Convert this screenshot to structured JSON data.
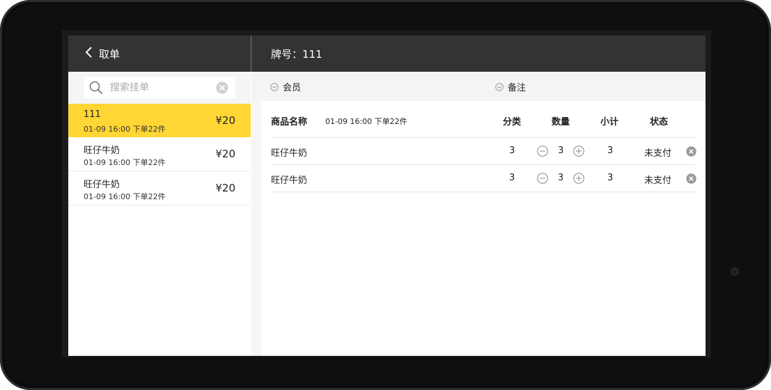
{
  "header": {
    "back_label": "取单",
    "table_label": "牌号：111"
  },
  "search": {
    "placeholder": "搜索挂单"
  },
  "orders": [
    {
      "name": "111",
      "meta": "01-09 16:00 下单22件",
      "price": "¥20",
      "active": true
    },
    {
      "name": "旺仔牛奶",
      "meta": "01-09 16:00 下单22件",
      "price": "¥20",
      "active": false
    },
    {
      "name": "旺仔牛奶",
      "meta": "01-09 16:00 下单22件",
      "price": "¥20",
      "active": false
    }
  ],
  "options": {
    "member_label": "会员",
    "note_label": "备注"
  },
  "table": {
    "headers": {
      "name": "商品名称",
      "time": "01-09 16:00 下单22件",
      "category": "分类",
      "quantity": "数量",
      "subtotal": "小计",
      "status": "状态"
    },
    "rows": [
      {
        "name": "旺仔牛奶",
        "category": "3",
        "quantity": "3",
        "subtotal": "3",
        "status": "未支付"
      },
      {
        "name": "旺仔牛奶",
        "category": "3",
        "quantity": "3",
        "subtotal": "3",
        "status": "未支付"
      }
    ]
  },
  "colors": {
    "accent": "#ffd634",
    "topbar": "#333333"
  },
  "icons": [
    "back-chevron-icon",
    "search-icon",
    "clear-icon",
    "dropdown-circle-icon",
    "minus-circle-icon",
    "plus-circle-icon",
    "delete-icon"
  ]
}
